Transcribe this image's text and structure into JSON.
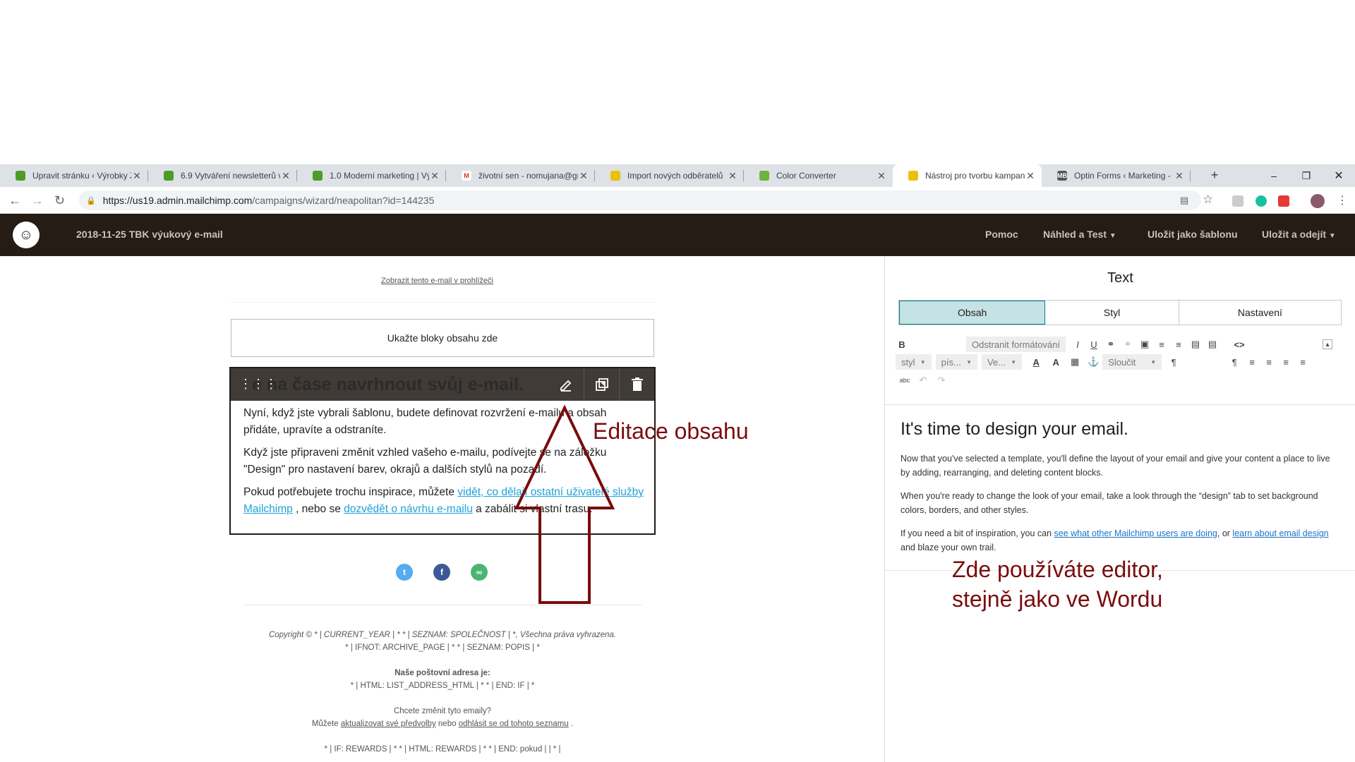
{
  "browser": {
    "tabs": [
      {
        "label": "Upravit stránku ‹ Výrobky Z",
        "fav_color": "#4b9d2a",
        "fav_text": ""
      },
      {
        "label": "6.9 Vytváření newsletterů v",
        "fav_color": "#4b9d2a",
        "fav_text": ""
      },
      {
        "label": "1.0 Moderní marketing | Vý",
        "fav_color": "#4b9d2a",
        "fav_text": ""
      },
      {
        "label": "životní sen - nomujana@gn",
        "fav_color": "#ffffff",
        "fav_text": "M"
      },
      {
        "label": "Import nových odběratelů",
        "fav_color": "#e9c10a",
        "fav_text": ""
      },
      {
        "label": "Color Converter",
        "fav_color": "#6cb33f",
        "fav_text": ""
      },
      {
        "label": "Nástroj pro tvorbu kampaní",
        "fav_color": "#e9c10a",
        "fav_text": ""
      },
      {
        "label": "Optin Forms ‹ Marketing -",
        "fav_color": "#555555",
        "fav_text": "MB"
      }
    ],
    "new_tab": "+",
    "url_host": "https://us19.admin.mailchimp.com",
    "url_path": "/campaigns/wizard/neapolitan?id=144235"
  },
  "header": {
    "campaign_name": "2018-11-25 TBK výukový e-mail",
    "help": "Pomoc",
    "preview": "Náhled a Test",
    "save_template": "Uložit jako šablonu",
    "save_send": "Uložit a odejít"
  },
  "email": {
    "view_in_browser": "Zobrazit tento e-mail v prohlížeči",
    "dropzone": "Ukažte bloky obsahu zde",
    "block_title": "e na čase navrhnout svůj e-mail.",
    "para1": "Nyní, když jste vybrali šablonu, budete definovat rozvržení e-mailu a obsah přidáte, upravíte a odstraníte.",
    "para2": "Když jste připraveni změnit vzhled vašeho e-mailu, podívejte se na záložku \"Design\" pro nastavení barev, okrajů a dalších stylů na pozadí.",
    "para3_a": "Pokud potřebujete trochu inspirace, můžete ",
    "para3_link1": "vidět, co dělají ostatní uživatelé služby Mailchimp",
    "para3_b": " , nebo se ",
    "para3_link2": "dozvědět o návrhu e-mailu",
    "para3_c": " a zabálit si vlastní trasu.",
    "footer": {
      "copyright": "Copyright © * | CURRENT_YEAR | * * | SEZNAM: SPOLEČNOST | *, Všechna práva vyhrazena.",
      "archive": "* | IFNOT: ARCHIVE_PAGE | * * | SEZNAM: POPIS | *",
      "address_title": "Naše poštovní adresa je:",
      "address": "* | HTML: LIST_ADDRESS_HTML | * * | END: IF | *",
      "change_q": "Chcete změnit tyto emaily?",
      "change_a": "Můžete ",
      "update_link": "aktualizovat své předvolby",
      "or": " nebo ",
      "unsub_link": "odhlásit se od tohoto seznamu",
      "dot": " .",
      "rewards": "* | IF: REWARDS | * * | HTML: REWARDS | * * | END: pokud | | * |"
    }
  },
  "panel": {
    "title": "Text",
    "tabs": [
      "Obsah",
      "Styl",
      "Nastavení"
    ],
    "remove_format": "Odstranit formátování",
    "style_sel": "styl",
    "font_sel": "pís...",
    "size_sel": "Ve...",
    "merge_sel": "Sloučit",
    "editor_heading": "It's time to design your email.",
    "editor_p1": "Now that you've selected a template, you'll define the layout of your email and give your content a place to live by adding, rearranging, and deleting content blocks.",
    "editor_p2": "When you're ready to change the look of your email, take a look through the “design” tab to set background colors, borders, and other styles.",
    "editor_p3_a": "If you need a bit of inspiration, you can ",
    "editor_p3_link1": "see what other Mailchimp users are doing",
    "editor_p3_b": ", or ",
    "editor_p3_link2": "learn about email design",
    "editor_p3_c": " and blaze your own trail."
  },
  "annotations": {
    "edit": "Editace obsahu",
    "editor_line1": "Zde používáte editor,",
    "editor_line2": "stejně jako ve Wordu"
  }
}
